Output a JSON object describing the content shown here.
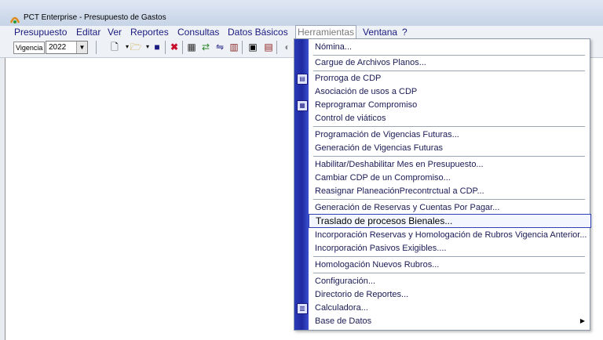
{
  "window": {
    "title": "PCT Enterprise - Presupuesto de Gastos"
  },
  "menubar": {
    "items": [
      {
        "label": "Presupuesto"
      },
      {
        "label": "Editar"
      },
      {
        "label": "Ver"
      },
      {
        "label": "Reportes"
      },
      {
        "label": "Consultas"
      },
      {
        "label": "Datos Básicos"
      },
      {
        "label": "Herramientas"
      },
      {
        "label": "Ventana"
      },
      {
        "label": "?"
      }
    ]
  },
  "toolbar": {
    "vigencia_label": "Vigencia",
    "vigencia_value": "2022"
  },
  "dropdown": {
    "items": [
      {
        "label": "Nómina..."
      },
      {
        "label": "Cargue de Archivos Planos..."
      },
      {
        "label": "Prorroga de CDP"
      },
      {
        "label": "Asociación de usos a CDP"
      },
      {
        "label": "Reprogramar Compromiso"
      },
      {
        "label": "Control de viáticos"
      },
      {
        "label": "Programación de Vigencias Futuras..."
      },
      {
        "label": "Generación de Vigencias Futuras"
      },
      {
        "label": "Habilitar/Deshabilitar Mes en Presupuesto..."
      },
      {
        "label": "Cambiar CDP de un Compromiso..."
      },
      {
        "label": "Reasignar PlaneaciónPrecontrctual a CDP..."
      },
      {
        "label": "Generación de Reservas y Cuentas Por Pagar..."
      },
      {
        "label": "Traslado de procesos Bienales..."
      },
      {
        "label": "Incorporación Reservas y Homologación de Rubros Vigencia Anterior..."
      },
      {
        "label": "Incorporación Pasivos Exigibles...."
      },
      {
        "label": "Homologación Nuevos Rubros..."
      },
      {
        "label": "Configuración..."
      },
      {
        "label": "Directorio de Reportes..."
      },
      {
        "label": "Calculadora..."
      },
      {
        "label": "Base de Datos"
      }
    ]
  },
  "colors": {
    "gutter": "#1f2aa0",
    "menu_text": "#1a1a80",
    "highlight_border": "#2d3fb5"
  }
}
